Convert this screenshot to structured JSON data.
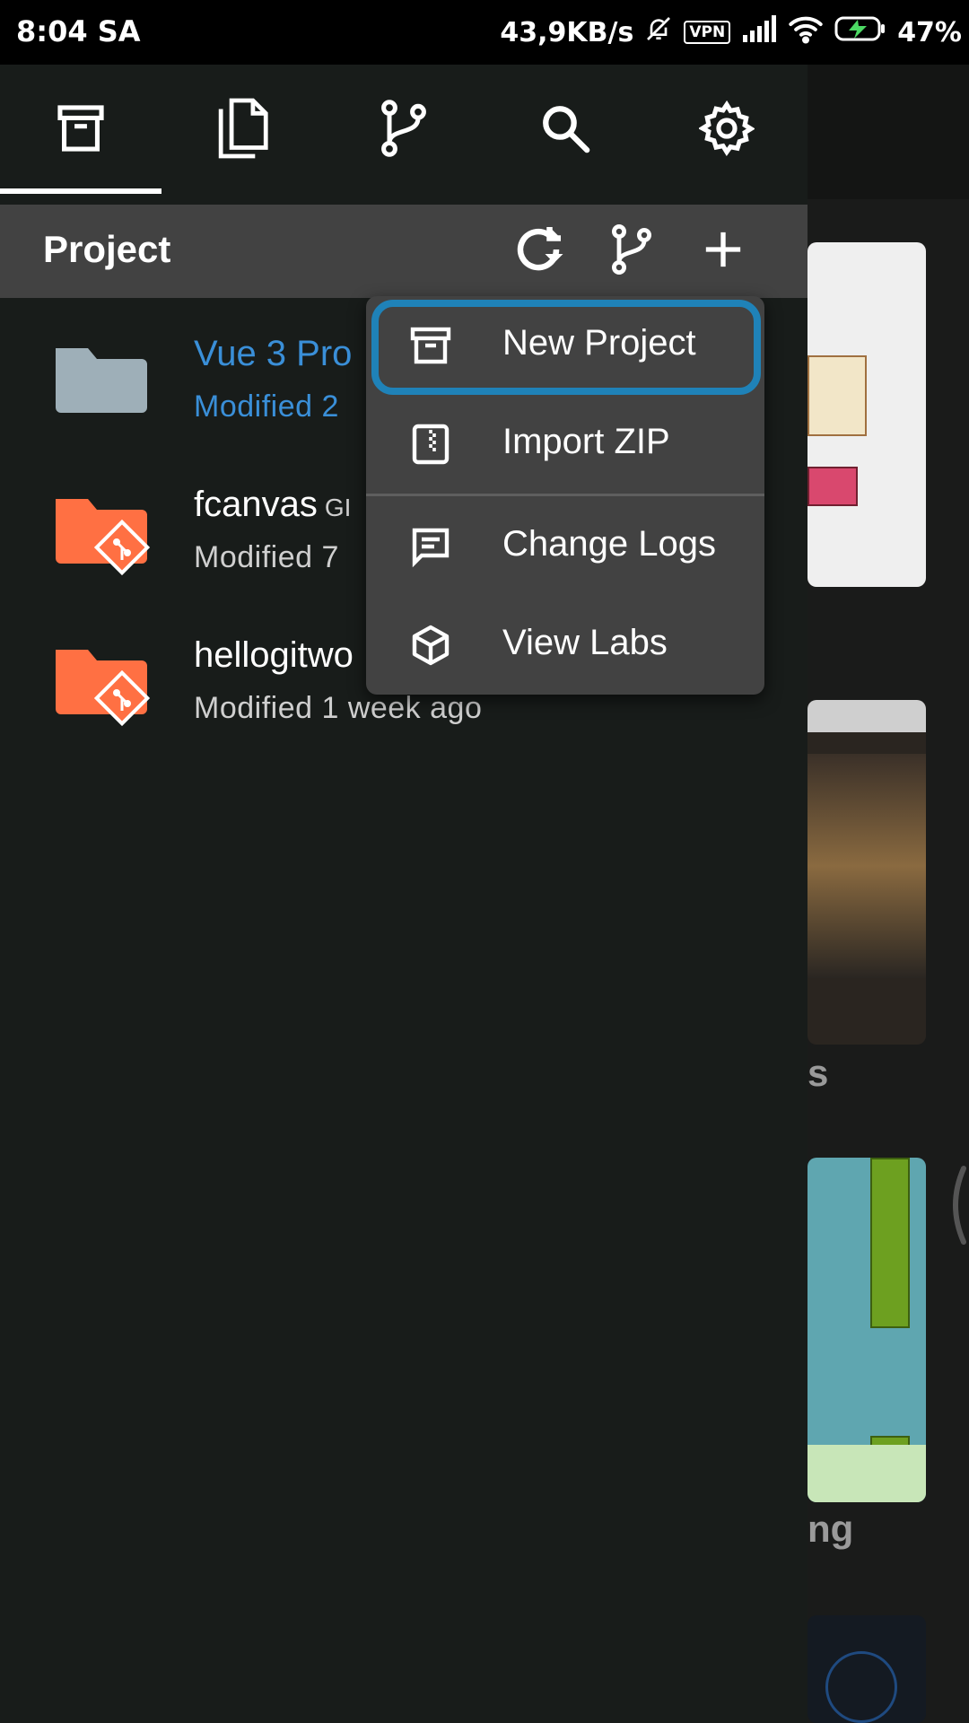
{
  "status_bar": {
    "time": "8:04 SA",
    "network_speed": "43,9KB/s",
    "vpn": "VPN",
    "battery": "47%",
    "icons": [
      "muted-bell-icon",
      "signal-icon",
      "wifi-icon",
      "battery-charging-icon"
    ]
  },
  "drawer": {
    "tabs": [
      {
        "name": "projects",
        "icon": "archive-icon",
        "active": true
      },
      {
        "name": "files",
        "icon": "copy-icon"
      },
      {
        "name": "git",
        "icon": "branch-icon"
      },
      {
        "name": "search",
        "icon": "search-icon"
      },
      {
        "name": "settings",
        "icon": "gear-icon"
      }
    ],
    "section_title": "Project",
    "header_actions": [
      "refresh-icon",
      "branch-icon",
      "plus-icon"
    ],
    "projects": [
      {
        "name": "Vue 3 Pro",
        "tag": "",
        "modified": "Modified 2",
        "active": true,
        "icon": "folder-icon"
      },
      {
        "name": "fcanvas",
        "tag": "GI",
        "modified": "Modified 7",
        "active": false,
        "icon": "git-folder-icon"
      },
      {
        "name": "hellogitwo",
        "tag": "",
        "modified": "Modified 1 week ago",
        "active": false,
        "icon": "git-folder-icon"
      }
    ]
  },
  "popup_menu": {
    "items": [
      {
        "label": "New Project",
        "icon": "archive-icon",
        "focused": true
      },
      {
        "label": "Import ZIP",
        "icon": "zip-file-icon"
      },
      {
        "label": "Change Logs",
        "icon": "message-icon"
      },
      {
        "label": "View Labs",
        "icon": "cube-icon"
      }
    ]
  },
  "background": {
    "text_fragments": [
      "s",
      "ng"
    ]
  },
  "colors": {
    "accent_blue": "#3a8fd8",
    "focus_ring": "#1f82b8",
    "git_folder": "#ff7043",
    "folder": "#9eafb8",
    "menu_bg": "#424242"
  }
}
